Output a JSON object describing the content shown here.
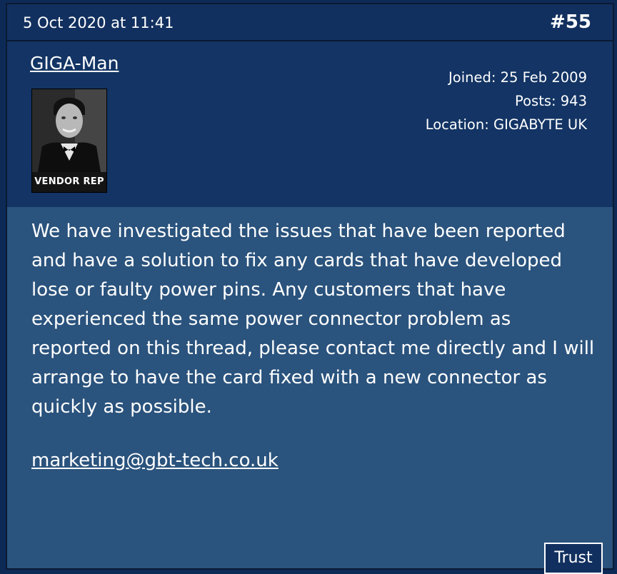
{
  "post": {
    "date": "5 Oct 2020 at 11:41",
    "number": "#55",
    "author": {
      "username": "GIGA-Man",
      "badge": "VENDOR REP",
      "joined": "Joined: 25 Feb 2009",
      "posts": "Posts: 943",
      "location": "Location: GIGABYTE UK"
    },
    "body": "We have investigated the issues that have been reported and have a solution to fix any cards that have developed lose or faulty power pins. Any customers that have experienced the same power connector problem as reported on this thread, please contact me directly and I will arrange to have the card fixed with a new connector as quickly as possible.",
    "email": "marketing@gbt-tech.co.uk",
    "trust_label": "Trust"
  },
  "colors": {
    "header_bg": "#12305f",
    "user_bg": "#133464",
    "body_bg": "#2a537d"
  }
}
